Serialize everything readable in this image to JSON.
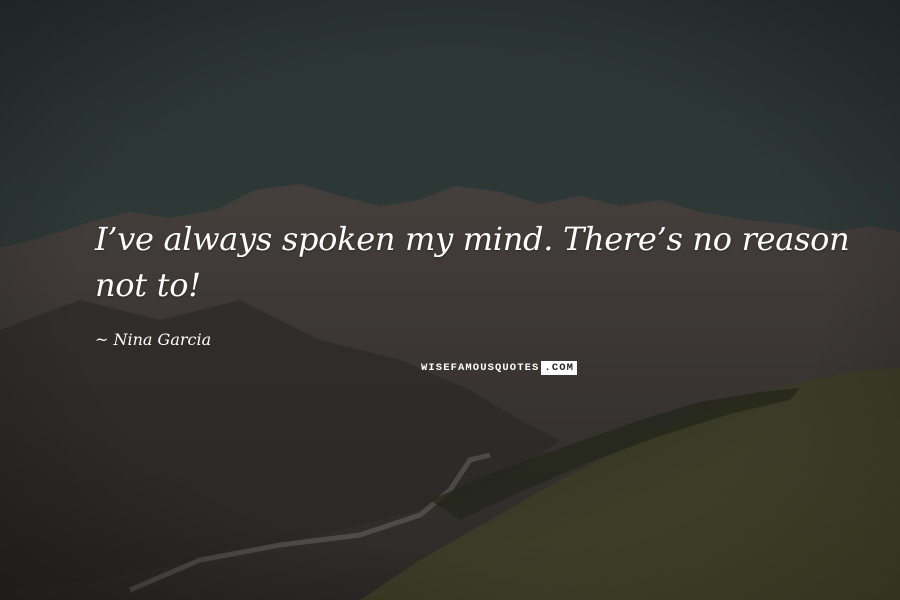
{
  "quote": {
    "text": "I’ve always spoken my mind. There’s no reason not to!",
    "author": "Nina Garcia"
  },
  "watermark": {
    "part1": "WISEFAMOUSQUOTES",
    "part2": ".COM"
  },
  "colors": {
    "sky": "#2b3534",
    "mountains": "#3a3533",
    "hillside": "#3c3f28",
    "text": "#ffffff"
  }
}
